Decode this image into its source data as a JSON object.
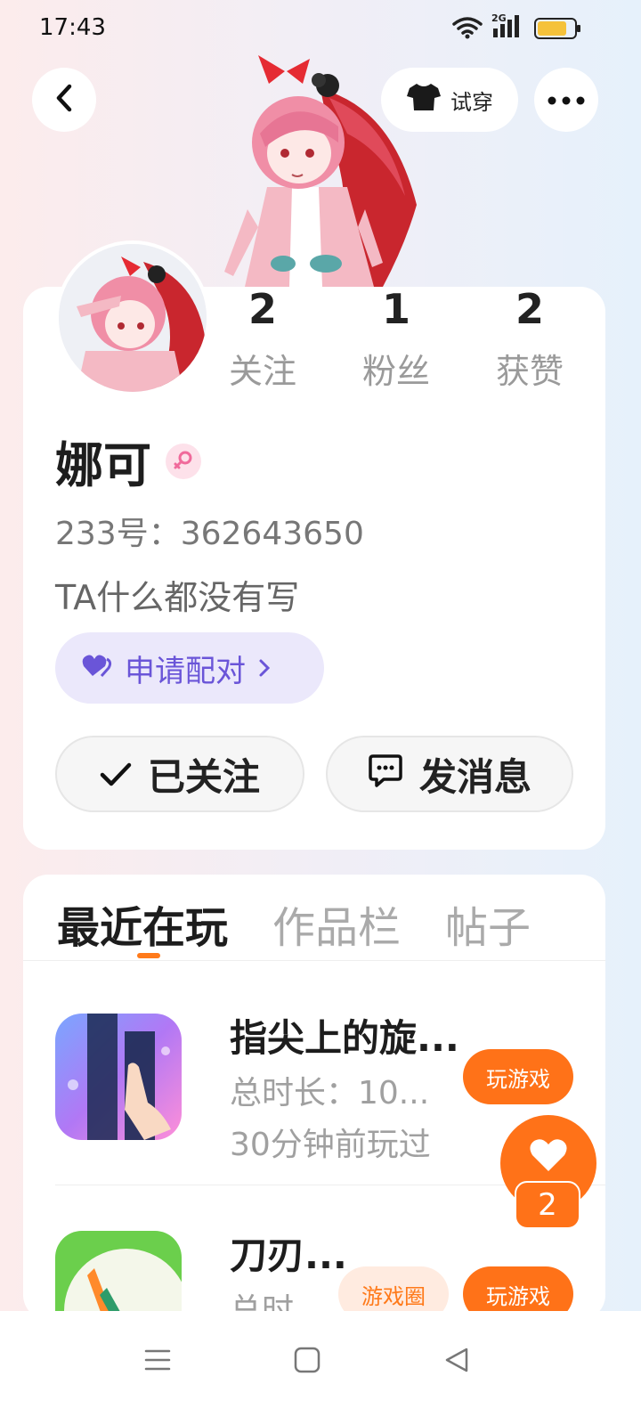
{
  "status_bar": {
    "time": "17:43",
    "network": "2G"
  },
  "top_bar": {
    "try_on_label": "试穿"
  },
  "profile": {
    "stats": [
      {
        "value": "2",
        "label": "关注"
      },
      {
        "value": "1",
        "label": "粉丝"
      },
      {
        "value": "2",
        "label": "获赞"
      }
    ],
    "nickname": "娜可",
    "gender": "female",
    "user_id": "233号：362643650",
    "bio": "TA什么都没有写",
    "pair_label": "申请配对",
    "follow_label": "已关注",
    "message_label": "发消息"
  },
  "tabs": [
    {
      "label": "最近在玩",
      "active": true
    },
    {
      "label": "作品栏",
      "active": false
    },
    {
      "label": "帖子",
      "active": false
    }
  ],
  "games": [
    {
      "title": "指尖上的旋...",
      "playtime": "总时长：10...",
      "last_played": "30分钟前玩过",
      "play_label": "玩游戏"
    },
    {
      "title": "刀刃...",
      "playtime": "总时...",
      "circle_label": "游戏圈",
      "play_label": "玩游戏"
    }
  ],
  "like_fab": {
    "count": "2"
  },
  "colors": {
    "accent": "#ff7218",
    "pair": "#6a55d8",
    "pair_bg": "#ebe8fb"
  },
  "icons": [
    "back-icon",
    "tshirt-icon",
    "more-icon",
    "female-icon",
    "heart-icon",
    "chevron-right-icon",
    "check-icon",
    "chat-icon",
    "menu-icon",
    "home-icon",
    "nav-back-icon"
  ]
}
